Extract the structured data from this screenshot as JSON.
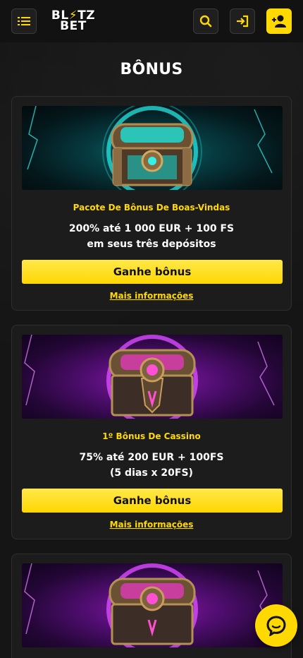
{
  "header": {
    "logo_line1": "BL",
    "logo_bolt": "⚡",
    "logo_line1b": "TZ",
    "logo_line2": "BET",
    "menu_icon": "menu-list-icon",
    "search_icon": "search-icon",
    "login_icon": "login-icon",
    "register_icon": "add-user-icon"
  },
  "page": {
    "title": "BÔNUS"
  },
  "cards": [
    {
      "banner_theme": "teal",
      "title": "Pacote De Bônus De Boas-Vindas",
      "desc_line1": "200% até 1 000 EUR + 100 FS",
      "desc_line2": "em seus três depósitos",
      "cta": "Ganhe bônus",
      "more": "Mais informações"
    },
    {
      "banner_theme": "purple",
      "title": "1º Bônus De Cassino",
      "desc_line1": "75% até 200 EUR + 100FS",
      "desc_line2": "(5 dias x 20FS)",
      "cta": "Ganhe bônus",
      "more": "Mais informações"
    },
    {
      "banner_theme": "purple"
    }
  ],
  "chat": {
    "icon": "chat-bubble-icon"
  },
  "colors": {
    "accent": "#ffd900",
    "background": "#141414",
    "card": "#1c1c1c"
  }
}
